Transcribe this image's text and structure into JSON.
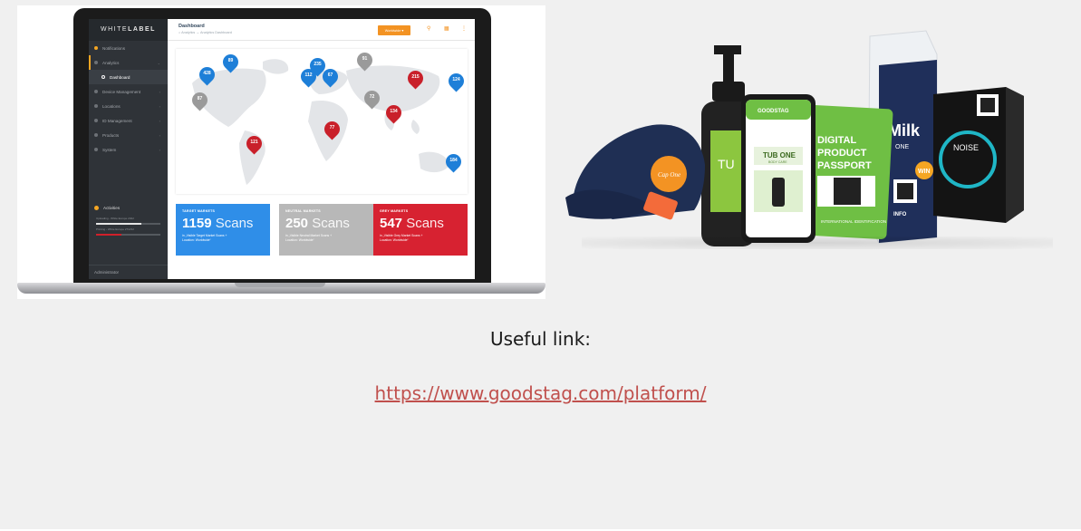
{
  "dashboard": {
    "brand": {
      "light": "WHITE",
      "bold": "LABEL"
    },
    "title": "Dashboard",
    "breadcrumb": "⌂ Analytics → Analytics Dashboard",
    "worldwide_button": "Worldwide ▾",
    "nav": [
      {
        "label": "Notifications"
      },
      {
        "label": "Analytics"
      },
      {
        "label": "Dashboard"
      },
      {
        "label": "Device Management"
      },
      {
        "label": "Locations"
      },
      {
        "label": "ID Management"
      },
      {
        "label": "Products"
      },
      {
        "label": "System"
      }
    ],
    "activities": {
      "title": "Activities",
      "items": [
        {
          "label": "Uploading - White Europe 2022",
          "progress": 0.7
        },
        {
          "label": "Printing - White Europe 27/2/22",
          "progress": 0.4
        }
      ]
    },
    "admin": "Administrator",
    "map_pins": [
      {
        "value": "89",
        "color": "blue"
      },
      {
        "value": "428",
        "color": "blue"
      },
      {
        "value": "87",
        "color": "grey"
      },
      {
        "value": "235",
        "color": "blue"
      },
      {
        "value": "112",
        "color": "blue"
      },
      {
        "value": "67",
        "color": "blue"
      },
      {
        "value": "91",
        "color": "grey"
      },
      {
        "value": "215",
        "color": "red"
      },
      {
        "value": "124",
        "color": "blue"
      },
      {
        "value": "72",
        "color": "grey"
      },
      {
        "value": "134",
        "color": "red"
      },
      {
        "value": "77",
        "color": "red"
      },
      {
        "value": "121",
        "color": "red"
      },
      {
        "value": "184",
        "color": "blue"
      }
    ],
    "stats": [
      {
        "label": "TARGET MARKETS",
        "number": "1159",
        "unit": "Scans",
        "sub": "in „Visible Target Market Scans +\nLocation: Worldwide“"
      },
      {
        "label": "NEUTRAL MARKETS",
        "number": "250",
        "unit": "Scans",
        "sub": "in „Visible Neutral Market Scans +\nLocation: Worldwide“"
      },
      {
        "label": "GREY MARKETS",
        "number": "547",
        "unit": "Scans",
        "sub": "in „Visible Grey Market Scans +\nLocation: Worldwide“"
      }
    ]
  },
  "products": {
    "phone_brand": "GOODSTAG",
    "phone_title": "TUB ONE",
    "phone_sub": "BODY CARE",
    "bottle_label": "TU",
    "cap_tag": "Cap One",
    "passport_title": [
      "DIGITAL",
      "PRODUCT",
      "PASSPORT"
    ],
    "passport_footer": "INTERNATIONAL IDENTIFICATION",
    "milk_label": "Milk",
    "milk_sub": "ONE",
    "milk_badge": "WIN",
    "milk_info": "INFO",
    "box_label": "NOISE"
  },
  "caption": "Useful link:",
  "link": "https://www.goodstag.com/platform/",
  "colors": {
    "orange": "#f39323",
    "blue": "#2f8ee8",
    "red": "#d72231",
    "grey": "#b8b8b8",
    "link": "#c0504d"
  }
}
